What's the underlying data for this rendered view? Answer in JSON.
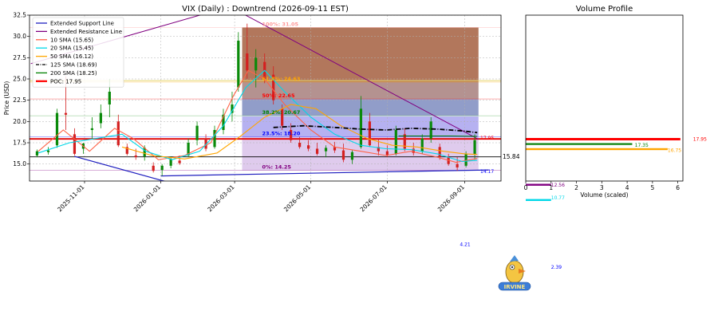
{
  "chart_data": [
    {
      "type": "candlestick",
      "title": "VIX (Daily) : Downtrend (2026-09-11 EST)",
      "ylabel": "Price (USD)",
      "ylim": [
        13.0,
        32.5
      ],
      "yticks": [
        "15.0",
        "17.5",
        "20.0",
        "22.5",
        "25.0",
        "27.5",
        "30.0",
        "32.5"
      ],
      "ytick_values": [
        15.0,
        17.5,
        20.0,
        22.5,
        25.0,
        27.5,
        30.0,
        32.5
      ],
      "xlim": [
        "2025-09-18",
        "2026-09-30"
      ],
      "xticks": [
        "2025-11-01",
        "2026-01-01",
        "2026-03-01",
        "2026-05-01",
        "2026-07-01",
        "2026-09-01"
      ],
      "grid": true,
      "legend_placement": "top-left",
      "legend": [
        {
          "label": "Extended Support Line",
          "color": "#1f1fbf",
          "style": "solid"
        },
        {
          "label": "Extended Resistance Line",
          "color": "#800080",
          "style": "solid"
        },
        {
          "label": "10 SMA (15.65)",
          "color": "#ff6347",
          "style": "solid"
        },
        {
          "label": "20 SMA (15.45)",
          "color": "#00d8e8",
          "style": "solid"
        },
        {
          "label": "50 SMA (16.12)",
          "color": "#ffa500",
          "style": "solid"
        },
        {
          "label": "125 SMA (18.69)",
          "color": "#000000",
          "style": "dashdot"
        },
        {
          "label": "200 SMA (18.25)",
          "color": "#008000",
          "style": "solid"
        },
        {
          "label": "POC: 17.95",
          "color": "#ff0000",
          "style": "solid"
        }
      ],
      "fib_levels": [
        {
          "label": "0%: 14.25",
          "value": 14.25,
          "color": "#800080"
        },
        {
          "label": "23.5%: 18.20",
          "value": 18.2,
          "color": "#0000ff"
        },
        {
          "label": "38.2%: 20.67",
          "value": 20.67,
          "color": "#008000"
        },
        {
          "label": "50%: 22.65",
          "value": 22.65,
          "color": "#ff0000"
        },
        {
          "label": "61.8%: 24.63",
          "value": 24.63,
          "color": "#ffa500"
        },
        {
          "label": "100%: 31.05",
          "value": 31.05,
          "color": "#ff9999"
        }
      ],
      "fib_start_date": "2026-03-07",
      "fib_end_date": "2026-09-12",
      "support_line": {
        "points": [
          {
            "x": "2025-10-24",
            "y": 15.9
          },
          {
            "x": "2026-02-02",
            "y": 11.8
          }
        ]
      },
      "support_line2": {
        "points": [
          {
            "x": "2026-01-01",
            "y": 13.6
          },
          {
            "x": "2026-09-20",
            "y": 14.3
          }
        ]
      },
      "resistance_line": {
        "points": [
          {
            "x": "2025-09-19",
            "y": 26.8
          },
          {
            "x": "2026-02-25",
            "y": 33.5
          },
          {
            "x": "2026-09-12",
            "y": 17.9
          }
        ]
      },
      "poc": 17.95,
      "last_close": 15.84,
      "hlines": [
        {
          "value": 17.95,
          "color": "#e00000"
        },
        {
          "value": 15.84,
          "color": "#000000"
        },
        {
          "value": 24.8,
          "color": "#e8d870"
        },
        {
          "value": 20.65,
          "color": "#c8e6c8"
        }
      ],
      "right_labels": [
        {
          "text": "15.84",
          "value": 15.84,
          "color": "#000000"
        },
        {
          "text": "14.17",
          "value": 14.17,
          "color": "#0000ff"
        },
        {
          "text": "17.95",
          "value": 18.1,
          "color": "#ff0000"
        }
      ],
      "series": [
        {
          "name": "10 SMA (15.65)",
          "color": "#ff6347",
          "x": [
            "2025-09-25",
            "2025-10-15",
            "2025-11-05",
            "2025-11-25",
            "2025-12-10",
            "2025-12-30",
            "2026-01-20",
            "2026-02-10",
            "2026-02-28",
            "2026-03-12",
            "2026-03-25",
            "2026-04-10",
            "2026-05-01",
            "2026-05-20",
            "2026-06-10",
            "2026-06-30",
            "2026-07-20",
            "2026-08-10",
            "2026-08-25",
            "2026-09-11"
          ],
          "y": [
            16.5,
            19.0,
            16.5,
            19.2,
            18.0,
            15.5,
            16.0,
            17.5,
            23.0,
            26.0,
            25.0,
            22.0,
            19.0,
            17.0,
            16.5,
            16.0,
            16.5,
            15.8,
            15.2,
            15.65
          ]
        },
        {
          "name": "20 SMA (15.45)",
          "color": "#00d8e8",
          "x": [
            "2025-09-25",
            "2025-10-20",
            "2025-11-10",
            "2025-12-01",
            "2025-12-20",
            "2026-01-10",
            "2026-02-01",
            "2026-02-20",
            "2026-03-10",
            "2026-03-25",
            "2026-04-10",
            "2026-05-01",
            "2026-05-20",
            "2026-06-10",
            "2026-06-30",
            "2026-07-20",
            "2026-08-10",
            "2026-08-30",
            "2026-09-11"
          ],
          "y": [
            16.3,
            17.5,
            18.0,
            18.5,
            16.5,
            15.5,
            16.5,
            19.5,
            24.0,
            26.0,
            23.5,
            20.5,
            18.5,
            17.2,
            16.8,
            16.7,
            16.2,
            15.3,
            15.45
          ]
        },
        {
          "name": "50 SMA (16.12)",
          "color": "#ffa500",
          "x": [
            "2025-12-01",
            "2025-12-25",
            "2026-01-20",
            "2026-02-15",
            "2026-03-05",
            "2026-03-25",
            "2026-04-15",
            "2026-05-05",
            "2026-05-25",
            "2026-06-15",
            "2026-07-05",
            "2026-07-25",
            "2026-08-15",
            "2026-09-01",
            "2026-09-11"
          ],
          "y": [
            17.0,
            16.0,
            15.6,
            16.3,
            18.2,
            20.5,
            22.0,
            21.5,
            19.5,
            18.0,
            17.2,
            17.0,
            16.5,
            16.2,
            16.12
          ]
        },
        {
          "name": "125 SMA (18.69)",
          "color": "#000000",
          "x": [
            "2026-04-01",
            "2026-04-25",
            "2026-05-20",
            "2026-06-10",
            "2026-06-30",
            "2026-07-20",
            "2026-08-10",
            "2026-08-30",
            "2026-09-11"
          ],
          "y": [
            19.3,
            19.5,
            19.3,
            19.1,
            19.0,
            19.2,
            19.1,
            18.9,
            18.69
          ]
        },
        {
          "name": "200 SMA (18.25)",
          "color": "#008000",
          "x": [
            "2026-07-10",
            "2026-07-30",
            "2026-08-20",
            "2026-09-11"
          ],
          "y": [
            18.3,
            18.3,
            18.3,
            18.25
          ]
        }
      ],
      "candles": [
        {
          "x": "2025-09-24",
          "o": 16.0,
          "h": 16.7,
          "l": 15.8,
          "c": 16.5
        },
        {
          "x": "2025-10-03",
          "o": 16.4,
          "h": 17.0,
          "l": 16.1,
          "c": 16.6
        },
        {
          "x": "2025-10-10",
          "o": 17.2,
          "h": 21.5,
          "l": 16.9,
          "c": 21.0
        },
        {
          "x": "2025-10-17",
          "o": 21.0,
          "h": 25.3,
          "l": 19.0,
          "c": 20.8
        },
        {
          "x": "2025-10-24",
          "o": 18.5,
          "h": 19.2,
          "l": 16.0,
          "c": 16.2
        },
        {
          "x": "2025-10-31",
          "o": 16.8,
          "h": 17.5,
          "l": 16.2,
          "c": 17.4
        },
        {
          "x": "2025-11-07",
          "o": 19.0,
          "h": 20.5,
          "l": 18.0,
          "c": 19.2
        },
        {
          "x": "2025-11-14",
          "o": 19.8,
          "h": 22.0,
          "l": 19.2,
          "c": 21.0
        },
        {
          "x": "2025-11-21",
          "o": 22.0,
          "h": 25.0,
          "l": 20.5,
          "c": 23.5
        },
        {
          "x": "2025-11-28",
          "o": 20.0,
          "h": 20.8,
          "l": 17.0,
          "c": 17.2
        },
        {
          "x": "2025-12-05",
          "o": 17.0,
          "h": 17.4,
          "l": 16.0,
          "c": 16.2
        },
        {
          "x": "2025-12-12",
          "o": 16.0,
          "h": 16.8,
          "l": 15.5,
          "c": 15.8
        },
        {
          "x": "2025-12-19",
          "o": 15.9,
          "h": 17.2,
          "l": 15.4,
          "c": 16.9
        },
        {
          "x": "2025-12-26",
          "o": 14.8,
          "h": 15.2,
          "l": 14.0,
          "c": 14.2
        },
        {
          "x": "2026-01-02",
          "o": 14.3,
          "h": 15.0,
          "l": 13.6,
          "c": 14.8
        },
        {
          "x": "2026-01-09",
          "o": 14.8,
          "h": 15.9,
          "l": 14.5,
          "c": 15.6
        },
        {
          "x": "2026-01-16",
          "o": 15.4,
          "h": 16.0,
          "l": 14.9,
          "c": 15.1
        },
        {
          "x": "2026-01-23",
          "o": 16.0,
          "h": 18.0,
          "l": 15.8,
          "c": 17.5
        },
        {
          "x": "2026-01-30",
          "o": 17.8,
          "h": 20.0,
          "l": 17.2,
          "c": 19.5
        },
        {
          "x": "2026-02-06",
          "o": 18.0,
          "h": 18.5,
          "l": 16.5,
          "c": 16.8
        },
        {
          "x": "2026-02-13",
          "o": 17.0,
          "h": 19.5,
          "l": 16.8,
          "c": 19.0
        },
        {
          "x": "2026-02-20",
          "o": 19.0,
          "h": 21.5,
          "l": 18.5,
          "c": 20.8
        },
        {
          "x": "2026-02-27",
          "o": 21.0,
          "h": 23.5,
          "l": 20.0,
          "c": 22.0
        },
        {
          "x": "2026-03-04",
          "o": 24.0,
          "h": 30.5,
          "l": 23.5,
          "c": 29.5
        },
        {
          "x": "2026-03-11",
          "o": 28.0,
          "h": 31.5,
          "l": 25.0,
          "c": 26.0
        },
        {
          "x": "2026-03-18",
          "o": 26.0,
          "h": 28.5,
          "l": 24.0,
          "c": 27.5
        },
        {
          "x": "2026-03-25",
          "o": 27.0,
          "h": 28.0,
          "l": 24.5,
          "c": 25.0
        },
        {
          "x": "2026-04-01",
          "o": 25.5,
          "h": 26.5,
          "l": 22.0,
          "c": 22.5
        },
        {
          "x": "2026-04-08",
          "o": 21.5,
          "h": 22.0,
          "l": 19.0,
          "c": 19.5
        },
        {
          "x": "2026-04-15",
          "o": 19.0,
          "h": 19.8,
          "l": 17.5,
          "c": 17.8
        },
        {
          "x": "2026-04-22",
          "o": 17.5,
          "h": 18.2,
          "l": 16.8,
          "c": 17.0
        },
        {
          "x": "2026-04-29",
          "o": 17.2,
          "h": 17.8,
          "l": 16.5,
          "c": 16.8
        },
        {
          "x": "2026-05-06",
          "o": 16.8,
          "h": 17.5,
          "l": 16.0,
          "c": 16.2
        },
        {
          "x": "2026-05-13",
          "o": 16.5,
          "h": 17.2,
          "l": 15.8,
          "c": 16.9
        },
        {
          "x": "2026-05-20",
          "o": 17.0,
          "h": 17.6,
          "l": 16.3,
          "c": 16.6
        },
        {
          "x": "2026-05-27",
          "o": 16.6,
          "h": 17.4,
          "l": 15.2,
          "c": 15.5
        },
        {
          "x": "2026-06-03",
          "o": 15.5,
          "h": 16.6,
          "l": 15.0,
          "c": 16.4
        },
        {
          "x": "2026-06-10",
          "o": 17.0,
          "h": 23.0,
          "l": 16.8,
          "c": 21.5
        },
        {
          "x": "2026-06-17",
          "o": 20.0,
          "h": 21.0,
          "l": 17.0,
          "c": 17.2
        },
        {
          "x": "2026-06-24",
          "o": 17.0,
          "h": 18.0,
          "l": 16.0,
          "c": 16.5
        },
        {
          "x": "2026-07-01",
          "o": 16.5,
          "h": 17.2,
          "l": 15.8,
          "c": 16.0
        },
        {
          "x": "2026-07-08",
          "o": 16.2,
          "h": 19.5,
          "l": 16.0,
          "c": 19.0
        },
        {
          "x": "2026-07-15",
          "o": 18.5,
          "h": 19.2,
          "l": 16.5,
          "c": 16.8
        },
        {
          "x": "2026-07-22",
          "o": 16.8,
          "h": 17.5,
          "l": 16.0,
          "c": 16.3
        },
        {
          "x": "2026-07-29",
          "o": 16.5,
          "h": 18.5,
          "l": 16.2,
          "c": 18.0
        },
        {
          "x": "2026-08-05",
          "o": 18.0,
          "h": 20.5,
          "l": 17.5,
          "c": 20.0
        },
        {
          "x": "2026-08-12",
          "o": 17.0,
          "h": 17.4,
          "l": 15.5,
          "c": 15.8
        },
        {
          "x": "2026-08-19",
          "o": 15.8,
          "h": 16.2,
          "l": 14.8,
          "c": 15.0
        },
        {
          "x": "2026-08-26",
          "o": 15.0,
          "h": 15.8,
          "l": 14.2,
          "c": 14.6
        },
        {
          "x": "2026-09-02",
          "o": 14.8,
          "h": 16.5,
          "l": 14.6,
          "c": 16.2
        },
        {
          "x": "2026-09-09",
          "o": 16.2,
          "h": 18.5,
          "l": 15.5,
          "c": 17.8
        }
      ]
    },
    {
      "type": "bar",
      "orientation": "horizontal",
      "title": "Volume Profile",
      "xlabel": "Volume (scaled)",
      "xlim": [
        0,
        6.2
      ],
      "xticks": [
        "0",
        "1",
        "2",
        "3",
        "4",
        "5",
        "6"
      ],
      "bars": [
        {
          "price": 17.95,
          "value": 6.1,
          "color": "#ff0000",
          "label": "17.95",
          "label_color": "#ff0000",
          "label_x": 6.6,
          "label_price": 17.95
        },
        {
          "price": 17.35,
          "value": 4.2,
          "color": "#1a8a1a",
          "label": "17.35",
          "label_color": "#008000",
          "label_x": 4.3,
          "label_price": 17.25
        },
        {
          "price": 16.75,
          "value": 5.6,
          "color": "#ffa500",
          "label": "16.75",
          "label_color": "#ffa500",
          "label_x": 5.6,
          "label_price": 16.65
        },
        {
          "price": 12.56,
          "value": 1.0,
          "color": "#800080",
          "label": "12.56",
          "label_color": "#800080",
          "label_x": 1.0,
          "label_price": 12.6
        },
        {
          "price": 10.77,
          "value": 1.0,
          "color": "#00d8e8",
          "label": "10.77",
          "label_color": "#00d8e8",
          "label_x": 1.0,
          "label_price": 11.1
        },
        {
          "price": 4.21,
          "value": 0.0,
          "color": "#0000ff",
          "label": "4.21",
          "label_color": "#0000ff",
          "label_x": -2.6,
          "label_price": 5.6
        },
        {
          "price": 2.39,
          "value": 0.0,
          "color": "#0000ff",
          "label": "2.39",
          "label_color": "#0000ff",
          "label_x": 1.0,
          "label_price": 2.9
        }
      ]
    }
  ],
  "watermark": {
    "text": "IRVINE",
    "description": "cartoon bird mascot logo"
  }
}
